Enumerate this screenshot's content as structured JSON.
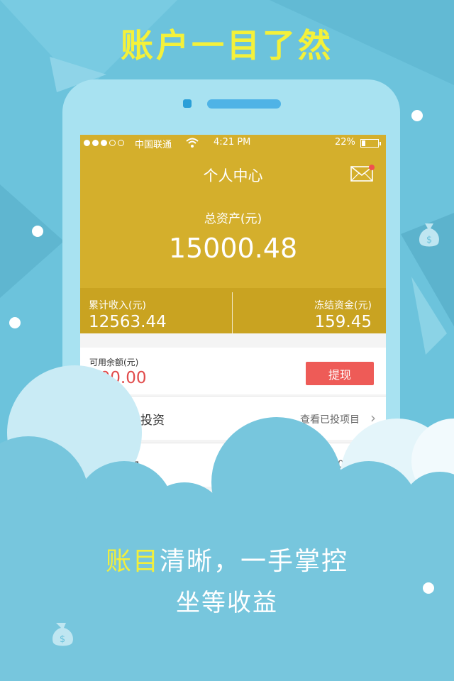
{
  "promo": {
    "headline": "账户一目了然",
    "tagline_highlight": "账目",
    "tagline_rest": "清晰，一手掌控",
    "sub_tagline": "坐等收益"
  },
  "status_bar": {
    "carrier": "中国联通",
    "time": "4:21 PM",
    "battery": "22%",
    "battery_level": 0.22,
    "signal_dots_filled": 3,
    "signal_dots_total": 5
  },
  "header": {
    "title": "个人中心"
  },
  "assets": {
    "total_label": "总资产(元)",
    "total_value": "15000.48",
    "income_label": "累计收入(元)",
    "income_value": "12563.44",
    "frozen_label": "冻结资金(元)",
    "frozen_value": "159.45"
  },
  "balance": {
    "label": "可用余额(元)",
    "value": "500.00",
    "withdraw_button": "提现"
  },
  "menu": [
    {
      "title": "我的投资",
      "link": "查看已投项目"
    },
    {
      "title": "记录",
      "link": "000.00"
    }
  ],
  "colors": {
    "background": "#6cc3dc",
    "gold": "#d4af2c",
    "gold_dark": "#c9a321",
    "accent_red": "#ee5b57",
    "headline_yellow": "#f4f13a"
  }
}
